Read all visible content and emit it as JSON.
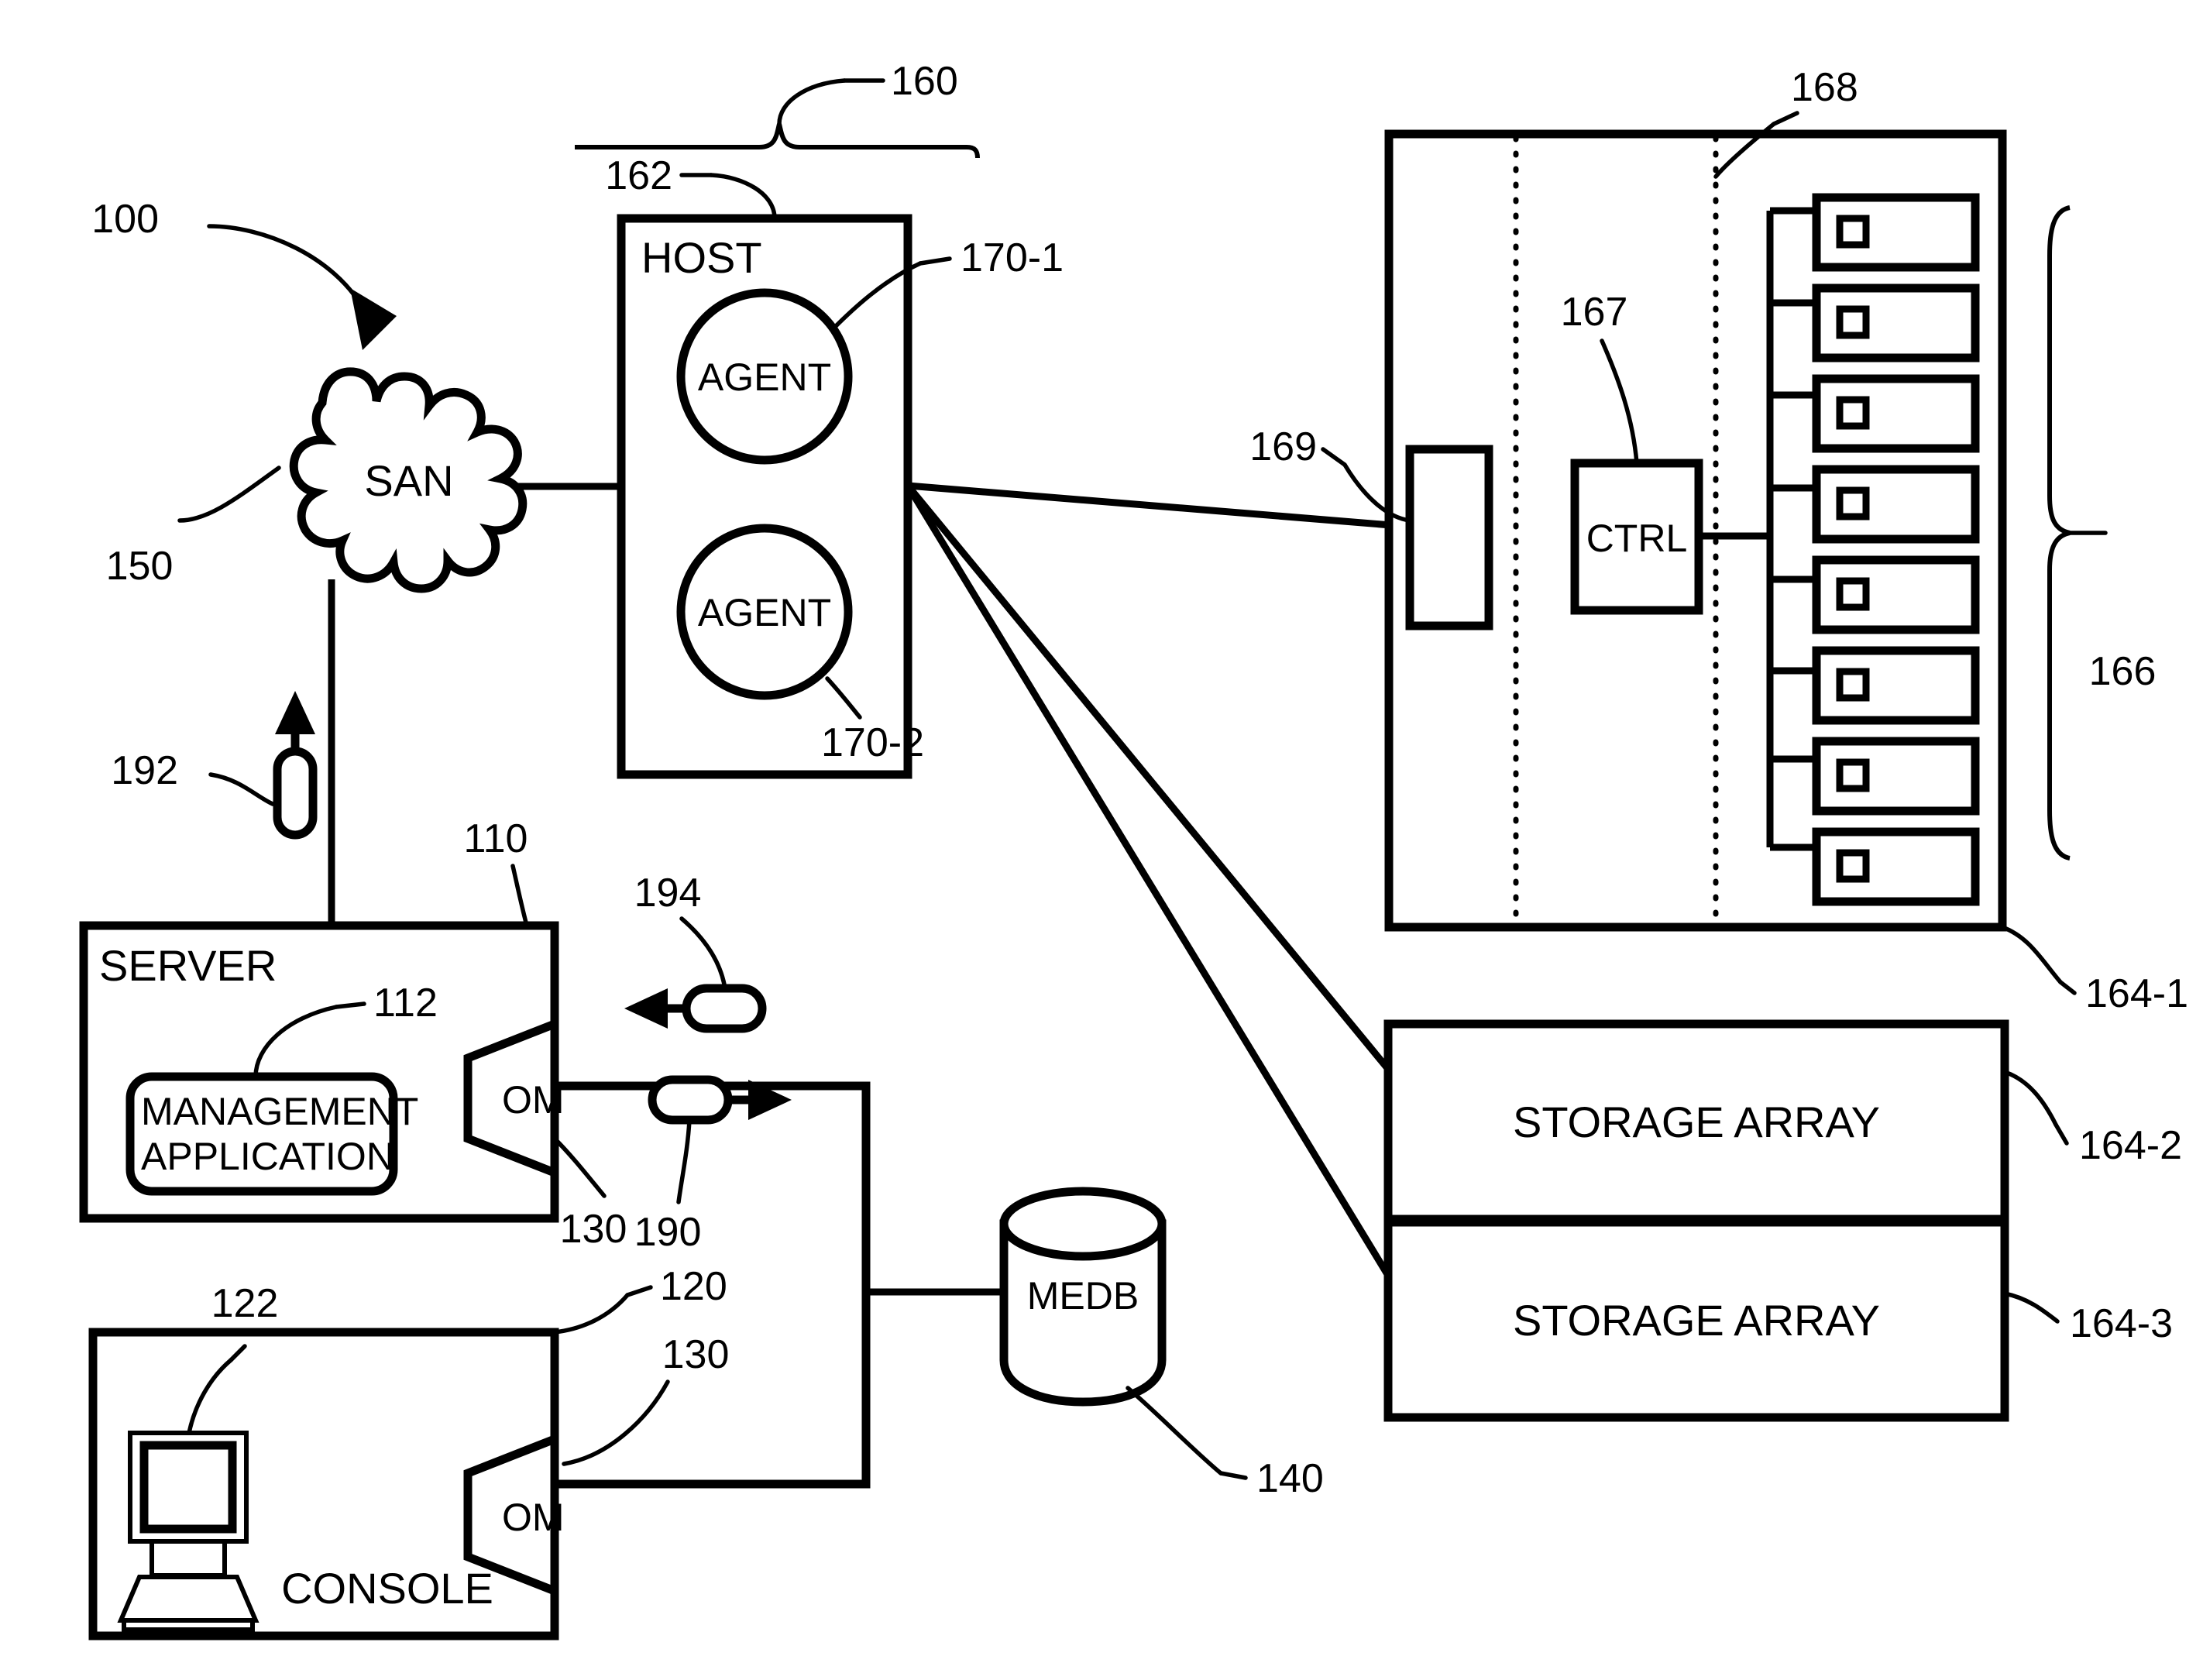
{
  "figure": {
    "type": "patent-block-diagram",
    "system_ref": "100"
  },
  "nodes": {
    "system": {
      "ref": "100"
    },
    "san": {
      "label": "SAN",
      "ref": "150"
    },
    "host_group": {
      "ref": "160"
    },
    "host": {
      "label": "HOST",
      "ref": "162"
    },
    "agent1": {
      "label": "AGENT",
      "ref": "170-1"
    },
    "agent2": {
      "label": "AGENT",
      "ref": "170-2"
    },
    "server": {
      "label": "SERVER",
      "ref": "110"
    },
    "management_application": {
      "label_line1": "MANAGEMENT",
      "label_line2": "APPLICATION",
      "ref": "112"
    },
    "server_om": {
      "label": "OM",
      "ref": "130"
    },
    "console": {
      "label": "CONSOLE",
      "ref": "120"
    },
    "console_display": {
      "ref": "122"
    },
    "console_om": {
      "label": "OM",
      "ref": "130"
    },
    "medb": {
      "label": "MEDB",
      "ref": "140"
    },
    "message_out": {
      "ref": "190"
    },
    "message_in": {
      "ref": "194"
    },
    "message_san": {
      "ref": "192"
    },
    "storage_array_1": {
      "ref": "164-1"
    },
    "storage_array_2": {
      "label": "STORAGE ARRAY",
      "ref": "164-2"
    },
    "storage_array_3": {
      "label": "STORAGE ARRAY",
      "ref": "164-3"
    },
    "array_port": {
      "ref": "169"
    },
    "array_ctrl": {
      "label": "CTRL",
      "ref": "167"
    },
    "array_partition": {
      "ref": "168"
    },
    "disk_group": {
      "ref": "166"
    }
  },
  "disks": [
    {
      "index": 1
    },
    {
      "index": 2
    },
    {
      "index": 3
    },
    {
      "index": 4
    },
    {
      "index": 5
    },
    {
      "index": 6
    },
    {
      "index": 7
    },
    {
      "index": 8
    }
  ],
  "refs": {
    "r100": "100",
    "r110": "110",
    "r112": "112",
    "r120": "120",
    "r122": "122",
    "r130a": "130",
    "r130b": "130",
    "r140": "140",
    "r150": "150",
    "r160": "160",
    "r162": "162",
    "r164_1": "164-1",
    "r164_2": "164-2",
    "r164_3": "164-3",
    "r166": "166",
    "r167": "167",
    "r168": "168",
    "r169": "169",
    "r170_1": "170-1",
    "r170_2": "170-2",
    "r190": "190",
    "r192": "192",
    "r194": "194"
  },
  "text": {
    "san": "SAN",
    "host": "HOST",
    "agent": "AGENT",
    "server": "SERVER",
    "mgmt_l1": "MANAGEMENT",
    "mgmt_l2": "APPLICATION",
    "om": "OM",
    "console": "CONSOLE",
    "medb": "MEDB",
    "ctrl": "CTRL",
    "storage_array": "STORAGE ARRAY"
  },
  "colors": {
    "ink": "#000000",
    "paper": "#ffffff"
  }
}
